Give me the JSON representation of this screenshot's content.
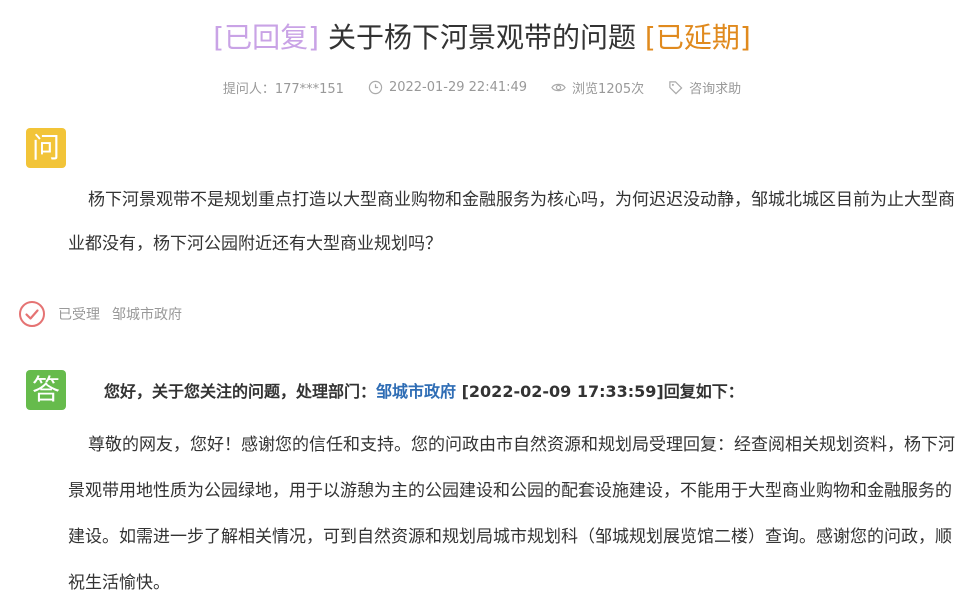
{
  "title": {
    "replied_tag": "[已回复]",
    "text": "关于杨下河景观带的问题",
    "extended_tag": "[已延期]"
  },
  "meta": {
    "asker": "提问人：177***151",
    "datetime": "2022-01-29 22:41:49",
    "views": "浏览1205次",
    "category": "咨询求助"
  },
  "question": {
    "badge": "问",
    "text": "杨下河景观带不是规划重点打造以大型商业购物和金融服务为核心吗，为何迟迟没动静，邹城北城区目前为止大型商业都没有，杨下河公园附近还有大型商业规划吗？"
  },
  "status": {
    "label": "已受理",
    "department": "邹城市政府"
  },
  "answer": {
    "badge": "答",
    "header_prefix": "您好，关于您关注的问题，处理部门：",
    "department_link": "邹城市政府",
    "header_suffix": " [2022-02-09 17:33:59]回复如下：",
    "body": "尊敬的网友，您好！感谢您的信任和支持。您的问政由市自然资源和规划局受理回复：经查阅相关规划资料，杨下河景观带用地性质为公园绿地，用于以游憩为主的公园建设和公园的配套设施建设，不能用于大型商业购物和金融服务的建设。如需进一步了解相关情况，可到自然资源和规划局城市规划科（邹城规划展览馆二楼）查询。感谢您的问政，顺祝生活愉快。"
  },
  "colors": {
    "replied_tag": "#c9a3e6",
    "extended_tag": "#e08a1e",
    "question_badge": "#f2c438",
    "answer_badge": "#66bb4c",
    "status_check": "#e57373",
    "link": "#2f6db5"
  },
  "icons": {
    "clock": "clock-icon",
    "eye": "eye-icon",
    "tag": "tag-icon",
    "check": "check-circle-icon"
  }
}
